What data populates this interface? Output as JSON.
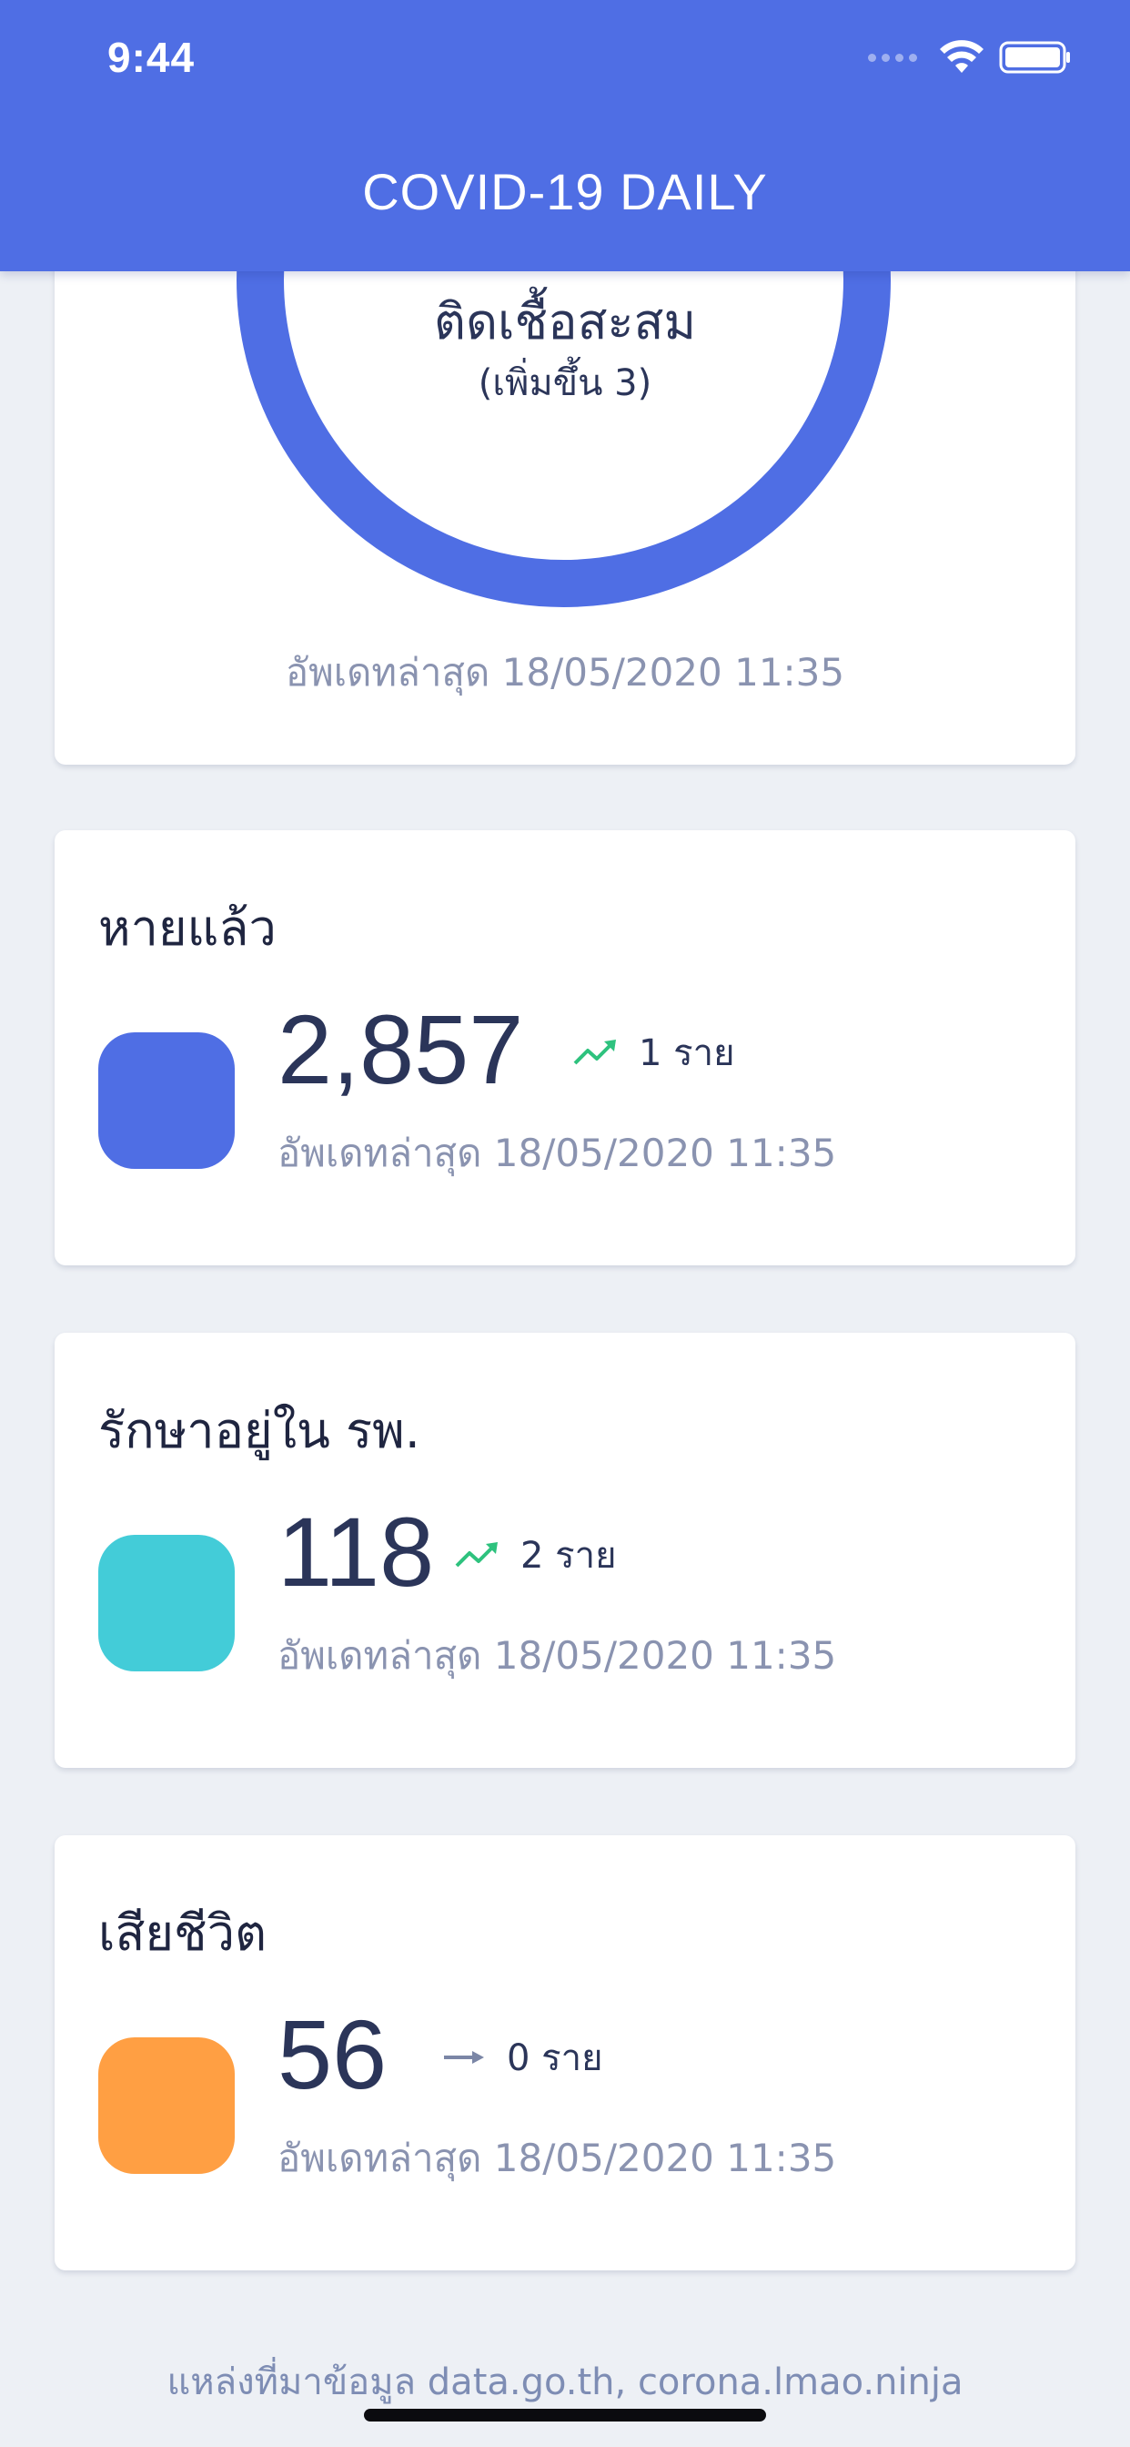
{
  "status_bar": {
    "time": "9:44",
    "wifi_icon": "wifi-icon",
    "battery_icon": "battery-icon"
  },
  "header": {
    "title": "COVID-19 DAILY"
  },
  "total_card": {
    "label": "ติดเชื้อสะสม",
    "change": "(เพิ่มขึ้น 3)",
    "updated": "อัพเดทล่าสุด 18/05/2020 11:35",
    "ring_color": "#4f6ee4"
  },
  "stats": [
    {
      "title": "หายแล้ว",
      "value": "2,857",
      "trend_icon": "trending-up-icon",
      "trend_text": "1 ราย",
      "updated": "อัพเดทล่าสุด 18/05/2020 11:35",
      "color": "#4f6ee4"
    },
    {
      "title": "รักษาอยู่ใน รพ.",
      "value": "118",
      "trend_icon": "trending-up-icon",
      "trend_text": "2 ราย",
      "updated": "อัพเดทล่าสุด 18/05/2020 11:35",
      "color": "#43ccd8"
    },
    {
      "title": "เสียชีวิต",
      "value": "56",
      "trend_icon": "arrow-right-icon",
      "trend_text": "0 ราย",
      "updated": "อัพเดทล่าสุด 18/05/2020 11:35",
      "color": "#ff9f43"
    }
  ],
  "footer": {
    "source": "แหล่งที่มาข้อมูล data.go.th, corona.lmao.ninja"
  },
  "colors": {
    "accent": "#4f6ee4",
    "trend_up": "#2ec27e",
    "trend_neutral": "#7b86a6"
  }
}
